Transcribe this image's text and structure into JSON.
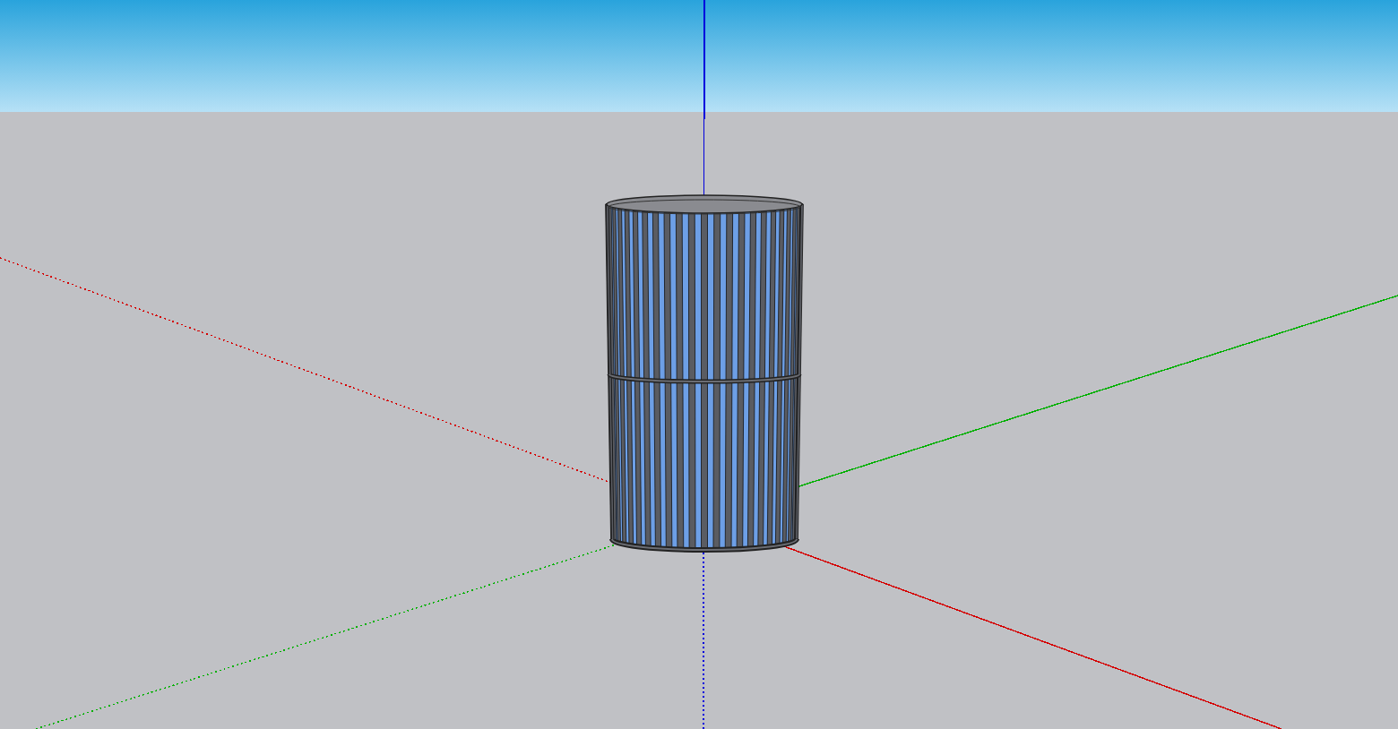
{
  "viewport": {
    "kind": "canvas"
  },
  "axes": [
    {
      "kind": "x",
      "color": "#d40000"
    },
    {
      "kind": "y",
      "color": "#00b000"
    },
    {
      "kind": "z",
      "color": "#0000dd"
    }
  ],
  "model": {
    "kind": "slotted-cylinder"
  }
}
